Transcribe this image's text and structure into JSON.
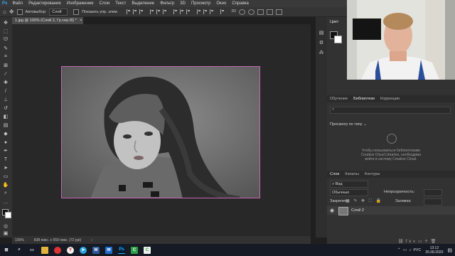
{
  "menu": [
    "Файл",
    "Редактирование",
    "Изображение",
    "Слои",
    "Текст",
    "Выделение",
    "Фильтр",
    "3D",
    "Просмотр",
    "Окно",
    "Справка"
  ],
  "options": {
    "autoselect_label": "Автовыбор:",
    "autoselect_value": "Слой",
    "show_controls_label": "Показать упр. элем."
  },
  "document": {
    "tab_title": "1.jpg @ 100% (Слой 2, Гр.сер./8) *",
    "status_zoom": "100%",
    "status_doc": "838 пикс. x 559 пикс. (72 ppi)"
  },
  "panels": {
    "color_tab": "Цвет",
    "library_tabs": [
      "Обучение",
      "Библиотеки",
      "Коррекции"
    ],
    "library_active": 1,
    "library_view_label": "Просмотр по типу",
    "library_msg_1": "Чтобы пользоваться библиотеками",
    "library_msg_2": "Creative Cloud Libraries, необходимо",
    "library_msg_3": "войти в систему Creative Cloud.",
    "layers_tabs": [
      "Слои",
      "Каналы",
      "Контуры"
    ],
    "layers_active": 0,
    "filter_label": "Вид",
    "blend_mode": "Обычные",
    "opacity_label": "Непрозрачность:",
    "lock_label": "Закрепить:",
    "fill_label": "Заливка:",
    "layer_name": "Слой 2"
  },
  "taskbar": {
    "lang": "РУС",
    "time": "13:12",
    "date": "26.08.2020"
  },
  "colors": {
    "ps_blue": "#31a8ff",
    "canvas_bg": "#282828",
    "panel_bg": "#323232",
    "selection_border": "#c766b5"
  }
}
